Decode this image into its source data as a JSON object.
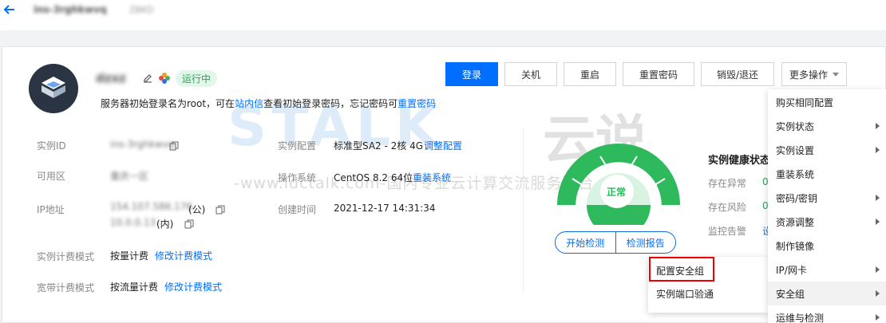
{
  "header": {
    "instance_name": "ins-3rghkwvq",
    "instance_sub": "ZBKD"
  },
  "instance": {
    "name": "dzxz",
    "status": "运行中",
    "hint_prefix": "服务器初始登录名为root，可在",
    "hint_link1": "站内信",
    "hint_middle": "查看初始登录密码，忘记密码可",
    "hint_link2": "重置密码"
  },
  "actions": {
    "login": "登录",
    "shutdown": "关机",
    "restart": "重启",
    "reset_password": "重置密码",
    "terminate": "销毁/退还",
    "more": "更多操作"
  },
  "info": {
    "id_label": "实例ID",
    "id_value": "ins-3rghkwvq",
    "zone_label": "可用区",
    "zone_value": "重庆一区",
    "ip_label": "IP地址",
    "ip_public": "154.107.586.176",
    "ip_public_suffix": "(公)",
    "ip_private": "10.0.0.13",
    "ip_private_suffix": "(内)",
    "billing_label": "实例计费模式",
    "billing_value": "按量计费",
    "billing_link": "修改计费模式",
    "bw_label": "宽带计费模式",
    "bw_value": "按流量计费",
    "bw_link": "修改计费模式",
    "config_label": "实例配置",
    "config_value": "标准型SA2 - 2核 4G",
    "config_link": "调整配置",
    "os_label": "操作系统",
    "os_value": "CentOS 8.2 64位",
    "os_link": "重装系统",
    "created_label": "创建时间",
    "created_value": "2021-12-17 14:31:34"
  },
  "health": {
    "gauge_label": "正常",
    "start_check": "开始检测",
    "check_report": "检测报告",
    "title": "实例健康状态",
    "rows": [
      {
        "label": "存在异常",
        "value": "0"
      },
      {
        "label": "存在风险",
        "value": "0"
      },
      {
        "label": "监控告警",
        "value": "设"
      }
    ]
  },
  "watermark": {
    "brand": "STALK",
    "brand_cn": "云说",
    "line": "-www.idctalk.com-国内专业云计算交流服务平台-"
  },
  "more_menu": {
    "items": [
      {
        "label": "购买相同配置",
        "arrow": false
      },
      {
        "label": "实例状态",
        "arrow": true
      },
      {
        "label": "实例设置",
        "arrow": true
      },
      {
        "label": "重装系统",
        "arrow": false
      },
      {
        "label": "密码/密钥",
        "arrow": true
      },
      {
        "label": "资源调整",
        "arrow": true
      },
      {
        "label": "制作镜像",
        "arrow": false
      },
      {
        "label": "IP/网卡",
        "arrow": true
      },
      {
        "label": "安全组",
        "arrow": true
      },
      {
        "label": "运维与检测",
        "arrow": true
      }
    ],
    "active_index": 8
  },
  "security_submenu": {
    "items": [
      {
        "label": "配置安全组"
      },
      {
        "label": "实例端口验通"
      }
    ]
  },
  "colors": {
    "primary": "#006eff",
    "success": "#29a35a",
    "gauge": "#2db95c",
    "highlight": "#ee0000"
  }
}
